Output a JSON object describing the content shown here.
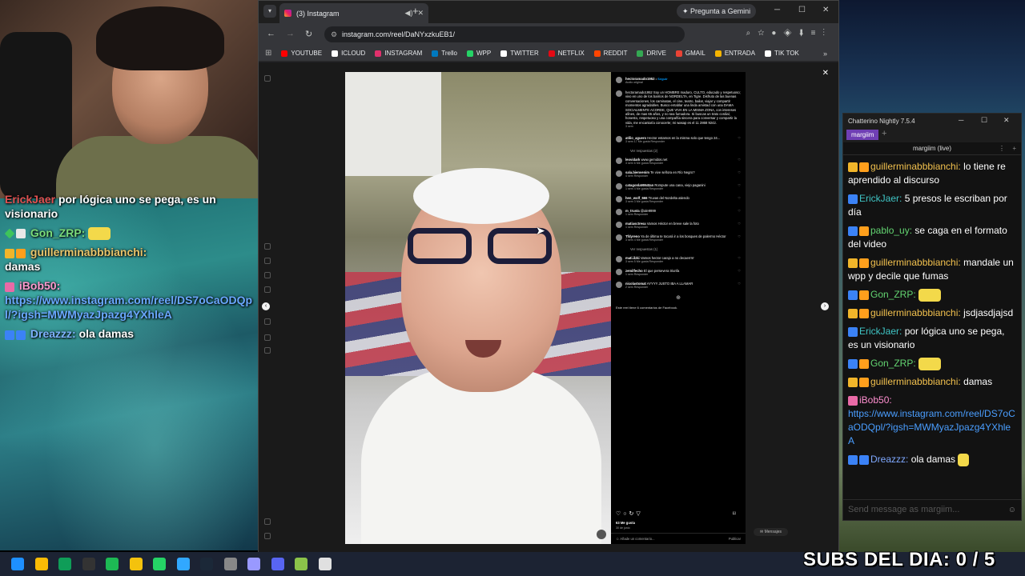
{
  "overlay_chat": [
    {
      "user": "ErickJaer",
      "text": "por lógica uno se pega, es un visionario",
      "color": "red"
    },
    {
      "user": "Gon_ZRP:",
      "text": "",
      "color": "green"
    },
    {
      "user": "guillerminabbbianchi:",
      "text": "damas",
      "color": "gold"
    },
    {
      "user": "iBob50:",
      "text": "https://www.instagram.com/reel/DS7oCaODQpl/?igsh=MWMyazJpazg4YXhleA",
      "color": "pink"
    },
    {
      "user": "Dreazzz:",
      "text": "ola damas",
      "color": "blue"
    }
  ],
  "browser": {
    "tab_title": "(3) Instagram",
    "gemini_label": "Pregunta a Gemini",
    "url": "instagram.com/reel/DaNYxzkuEB1/",
    "bookmarks": [
      "YOUTUBE",
      "ICLOUD",
      "INSTAGRAM",
      "Trello",
      "WPP",
      "TWITTER",
      "NETFLIX",
      "REDDIT",
      "DRIVE",
      "GMAIL",
      "ENTRADA",
      "TIK TOK"
    ],
    "bookmark_colors": [
      "#ff0000",
      "#ffffff",
      "#e1306c",
      "#0079bf",
      "#25d366",
      "#ffffff",
      "#e50914",
      "#ff4500",
      "#34a853",
      "#ea4335",
      "#f4b400",
      "#ffffff"
    ]
  },
  "instagram": {
    "author": "hectoramado1952",
    "follow": "Seguir",
    "audio": "Audio original",
    "caption": "hectoramado1952 Soy un HOMBRE maduro, CULTO, educado y respetuoso; vivo en uno de los barrios de NORDELTA, en Tigre. Disfruto de las buenas conversaciones, los caminatas, el cine, teatro, bailar, viajar y compartir momentos agradables. Busco entablar una linda amistad con una DAMA SOCIALMENTE ACORDE, QUE VIVA EN LA MISMA ZONA, con intereses afines, de mas 65 años, y no sea fumadora. Si buscas un trato cordial, honesto, respetuoso y una compañía sincera para conversar y compartir la vida, me encantaría conocerte; mi wasap es el 11 2868 9242.",
    "caption_time": "3 sem",
    "comments": [
      {
        "user": "atilio_aguero",
        "text": "Hector estamos en la misma solo que tengo 24...",
        "meta": "3 sem   17 Me gusta   Responder"
      },
      {
        "user": "",
        "text": "Ver respuestas (2)",
        "meta": ""
      },
      {
        "user": "leovidark",
        "text": "www.gemidos.net",
        "meta": "3 sem   6 Me gusta   Responder"
      },
      {
        "user": "sala.bienvenim",
        "text": "Te vive señora en Río Negro?",
        "meta": "4 sem   Responder"
      },
      {
        "user": "catagonla9064tan",
        "text": "Rompute una cana, viejo paganini",
        "meta": "1 sem   4 Me gusta   Responder"
      },
      {
        "user": "hen_wolf_666",
        "text": "Truvas del Nordelta atiendo",
        "meta": "3 sem   3 Me gusta   Responder"
      },
      {
        "user": "m_trusta",
        "text": "@ale9999",
        "meta": "1 sem   Responder"
      },
      {
        "user": "matiasctresa",
        "text": "Vamos Héctor en breve sale la foto",
        "meta": "1 sem   Responder"
      },
      {
        "user": "Tfdyreno",
        "text": "Ya de última te tocará ir a los bosques de palermo Héctor",
        "meta": "3 sem   4 Me gusta   Responder"
      },
      {
        "user": "",
        "text": "Ver respuestas (1)",
        "meta": ""
      },
      {
        "user": "mati.ilzki",
        "text": "Vamos hector carajo a no decaerrrrr",
        "meta": "3 sem   5 Me gusta   Responder"
      },
      {
        "user": "zemilfecho",
        "text": "El que persevera triunfa",
        "meta": "1 sem   Responder"
      },
      {
        "user": "nicolastomat",
        "text": "AYYYY JUSTO IBA A LLAMAR",
        "meta": "2 sem   Responder"
      }
    ],
    "fb_note": "Este reel tiene 6 comentarios de Facebook.",
    "likes": "63 Me gusta",
    "date": "30 de junio",
    "add_comment": "Añade un comentario...",
    "post_label": "Publicar",
    "messages_label": "Mensajes"
  },
  "chatterino": {
    "title": "Chatterino Nightly 7.5.4",
    "tab": "margiim",
    "channel": "margiim (live)",
    "input_placeholder": "Send message as margiim...",
    "messages": [
      {
        "user": "guillerminabbbianchi:",
        "text": "lo tiene re aprendido al discurso",
        "color": "gold"
      },
      {
        "user": "ErickJaer:",
        "text": "5 presos le escriban por día",
        "color": "cyan"
      },
      {
        "user": "pablo_uy:",
        "text": "se caga en el formato del video",
        "color": "green"
      },
      {
        "user": "guillerminabbbianchi:",
        "text": "mandale un wpp y decile que fumas",
        "color": "gold"
      },
      {
        "user": "Gon_ZRP:",
        "text": "",
        "color": "green"
      },
      {
        "user": "guillerminabbbianchi:",
        "text": "jsdjasdjajsd",
        "color": "gold"
      },
      {
        "user": "ErickJaer:",
        "text": "por lógica uno se pega, es un visionario",
        "color": "cyan"
      },
      {
        "user": "Gon_ZRP:",
        "text": "",
        "color": "green"
      },
      {
        "user": "guillerminabbbianchi:",
        "text": "damas",
        "color": "gold"
      },
      {
        "user": "iBob50:",
        "text": "https://www.instagram.com/reel/DS7oCaODQpl/?igsh=MWMyazJpazg4YXhleA",
        "color": "pink"
      },
      {
        "user": "Dreazzz:",
        "text": "ola damas",
        "color": "blue"
      }
    ]
  },
  "subs_counter": "SUBS DEL DIA: 0 / 5",
  "taskbar_icons": [
    "windows-icon",
    "chrome-icon",
    "edge-icon",
    "obs-icon",
    "spotify-icon",
    "file-explorer-icon",
    "whatsapp-icon",
    "photoshop-icon",
    "steam-icon",
    "chatgpt-icon",
    "premiere-icon",
    "discord-icon",
    "notepad-icon",
    "chatterino-icon"
  ]
}
